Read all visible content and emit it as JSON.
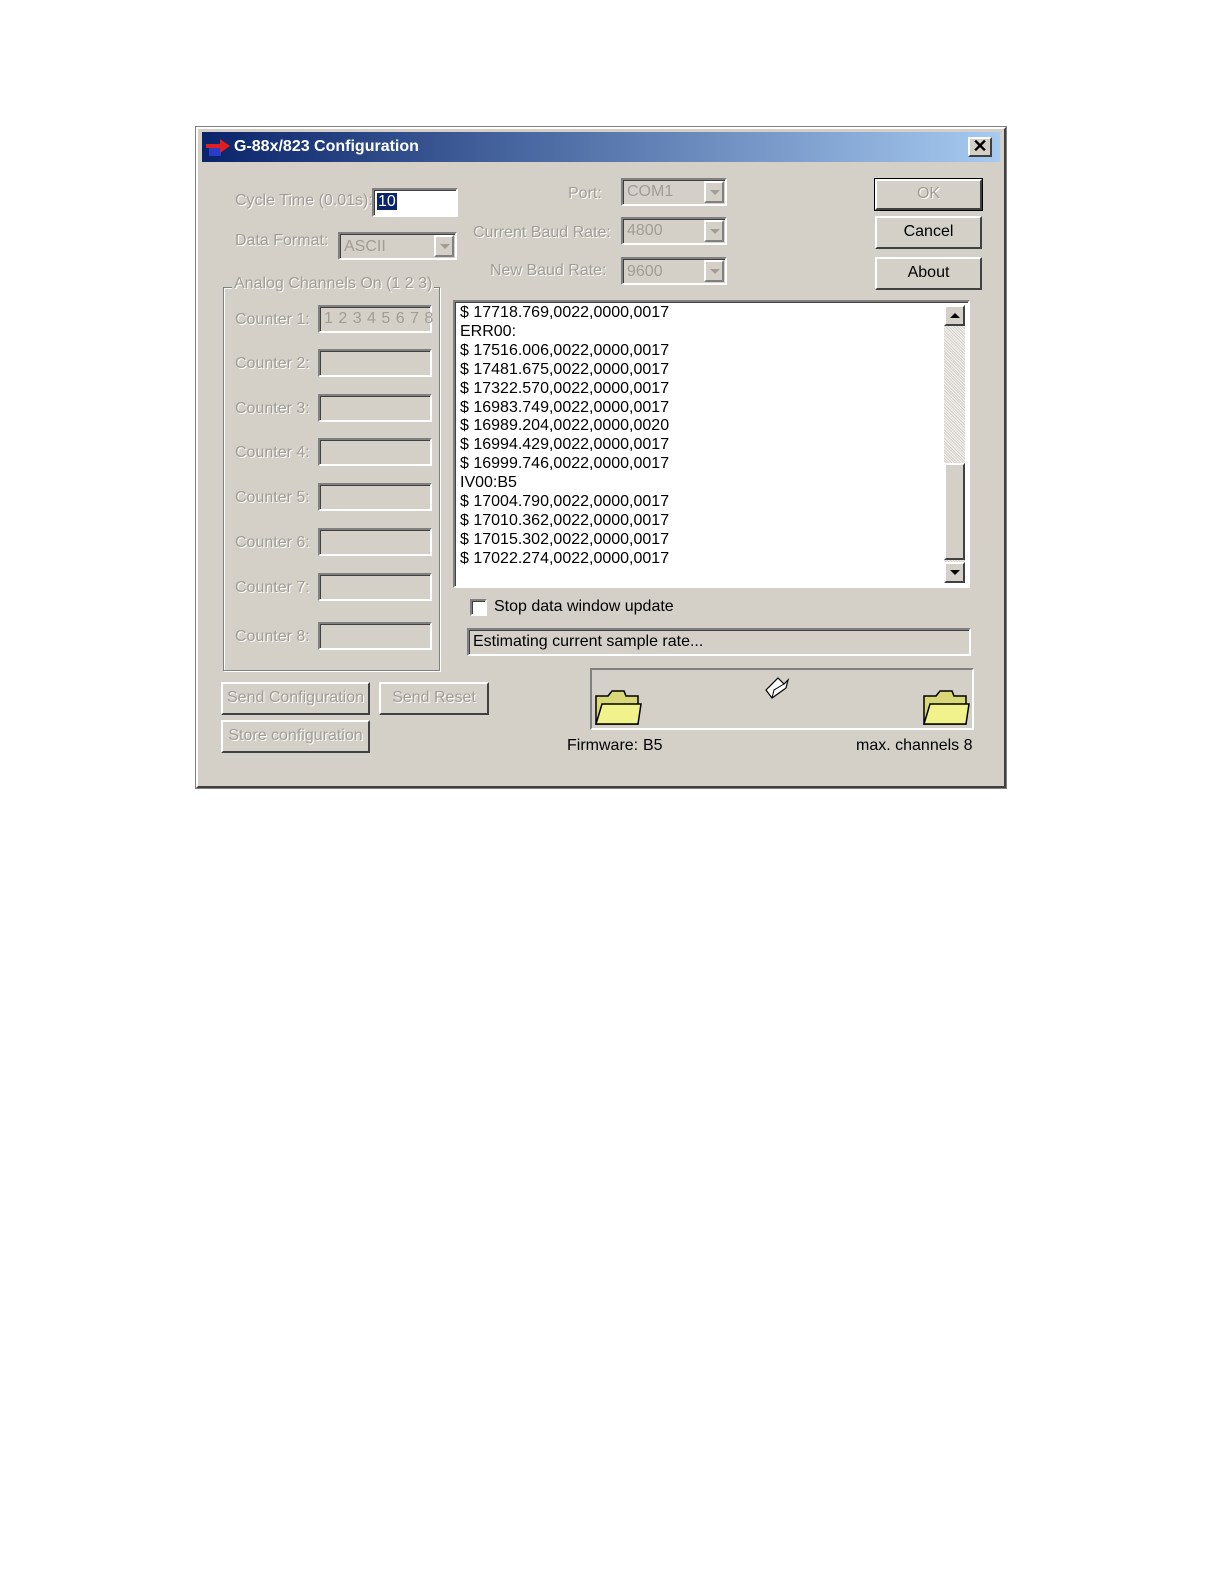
{
  "window": {
    "title": "G-88x/823 Configuration",
    "close_glyph": "✕"
  },
  "settings": {
    "cycle_time_label": "Cycle Time (0.01s):",
    "cycle_time_value": "10",
    "data_format_label": "Data Format:",
    "data_format_value": "ASCII",
    "port_label": "Port:",
    "port_value": "COM1",
    "current_baud_label": "Current Baud Rate:",
    "current_baud_value": "4800",
    "new_baud_label": "New Baud Rate:",
    "new_baud_value": "9600"
  },
  "buttons": {
    "ok": "OK",
    "cancel": "Cancel",
    "about": "About",
    "send_configuration": "Send Configuration",
    "send_reset": "Send Reset",
    "store_configuration": "Store configuration"
  },
  "analog_group": {
    "title": "Analog Channels On (1 2 3)",
    "counters": [
      {
        "label": "Counter 1:",
        "value": "1 2 3 4 5 6 7 8"
      },
      {
        "label": "Counter 2:",
        "value": ""
      },
      {
        "label": "Counter 3:",
        "value": ""
      },
      {
        "label": "Counter 4:",
        "value": ""
      },
      {
        "label": "Counter 5:",
        "value": ""
      },
      {
        "label": "Counter 6:",
        "value": ""
      },
      {
        "label": "Counter 7:",
        "value": ""
      },
      {
        "label": "Counter 8:",
        "value": ""
      }
    ]
  },
  "log": {
    "lines": [
      "$ 17718.769,0022,0000,0017",
      "ERR00:",
      "$ 17516.006,0022,0000,0017",
      "$ 17481.675,0022,0000,0017",
      "$ 17322.570,0022,0000,0017",
      "$ 16983.749,0022,0000,0017",
      "$ 16989.204,0022,0000,0020",
      "$ 16994.429,0022,0000,0017",
      "$ 16999.746,0022,0000,0017",
      "IV00:B5",
      "$ 17004.790,0022,0000,0017",
      "$ 17010.362,0022,0000,0017",
      "$ 17015.302,0022,0000,0017",
      "$ 17022.274,0022,0000,0017"
    ]
  },
  "stop_update": {
    "label": "Stop data window update",
    "checked": false
  },
  "status_text": "Estimating current sample rate...",
  "firmware": {
    "label": "Firmware:",
    "value": "B5"
  },
  "max_channels": "max. channels 8",
  "icons": {
    "title": "app-arrow-icon",
    "folders": "folder-icon",
    "transfer": "paper-icon"
  }
}
